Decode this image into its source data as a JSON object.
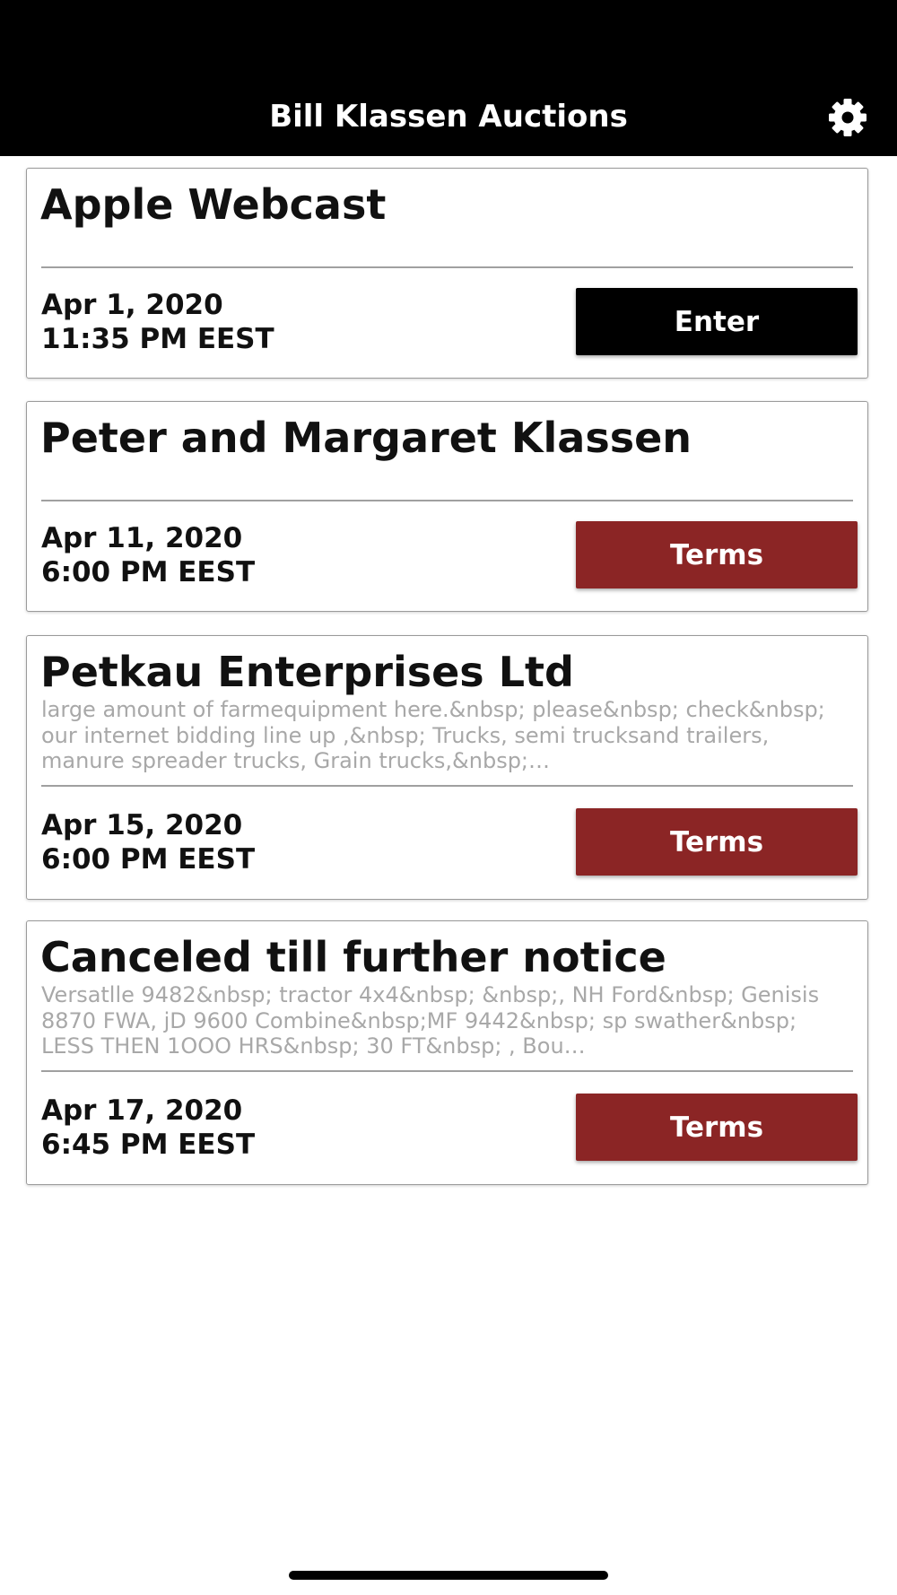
{
  "app": {
    "title": "Bill Klassen Auctions",
    "settings_icon": "gear-icon"
  },
  "colors": {
    "header_bg": "#000000",
    "enter_button": "#000000",
    "terms_button": "#8b2525",
    "description_text": "#a8a8a8"
  },
  "auctions": [
    {
      "title": "Apple Webcast",
      "description": "",
      "date": "Apr 1, 2020",
      "time": "11:35 PM EEST",
      "button_label": "Enter"
    },
    {
      "title": "Peter and Margaret Klassen",
      "description": "",
      "date": "Apr 11, 2020",
      "time": "6:00 PM EEST",
      "button_label": "Terms"
    },
    {
      "title": "Petkau Enterprises  Ltd",
      "description": "large amount of farmequipment here.&nbsp; please&nbsp; check&nbsp; our internet bidding line up ,&nbsp; Trucks, semi trucksand trailers, manure spreader trucks, Grain trucks,&nbsp;…",
      "date": "Apr 15, 2020",
      "time": "6:00 PM EEST",
      "button_label": "Terms"
    },
    {
      "title": "Canceled till further notice",
      "description": "Versatlle 9482&nbsp; tractor 4x4&nbsp; &nbsp;, NH Ford&nbsp; Genisis 8870 FWA, jD 9600 Combine&nbsp;MF 9442&nbsp; sp swather&nbsp; LESS THEN 1OOO HRS&nbsp; 30 FT&nbsp; , Bou…",
      "date": "Apr 17, 2020",
      "time": "6:45 PM EEST",
      "button_label": "Terms"
    }
  ]
}
